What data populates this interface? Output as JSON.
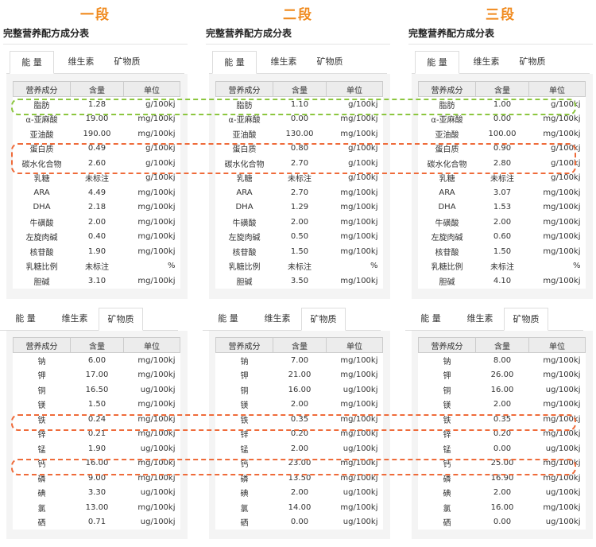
{
  "colors": {
    "stage_orange": "#f08a1e",
    "highlight_green": "#8cc63f",
    "highlight_orange": "#ef6b3a"
  },
  "stages": [
    "一段",
    "二段",
    "三段"
  ],
  "page_title": "完整营养配方成分表",
  "tabs": [
    "能 量",
    "维生素",
    "矿物质"
  ],
  "headers": [
    "营养成分",
    "含量",
    "单位"
  ],
  "energy_names": [
    "脂肪",
    "α-亚麻酸",
    "亚油酸",
    "蛋白质",
    "碳水化合物",
    "乳糖",
    "ARA",
    "DHA",
    "牛磺酸",
    "左旋肉碱",
    "核苷酸",
    "乳糖比例",
    "胆碱"
  ],
  "energy_units": [
    "g/100kj",
    "mg/100kj",
    "mg/100kj",
    "g/100kj",
    "g/100kj",
    "g/100kj",
    "mg/100kj",
    "mg/100kj",
    "mg/100kj",
    "mg/100kj",
    "mg/100kj",
    "%",
    "mg/100kj"
  ],
  "energy_values": [
    [
      "1.28",
      "19.00",
      "190.00",
      "0.49",
      "2.60",
      "未标注",
      "4.49",
      "2.18",
      "2.00",
      "0.40",
      "1.90",
      "未标注",
      "3.10"
    ],
    [
      "1.10",
      "0.00",
      "130.00",
      "0.80",
      "2.70",
      "未标注",
      "2.70",
      "1.29",
      "2.00",
      "0.50",
      "1.50",
      "未标注",
      "3.50"
    ],
    [
      "1.00",
      "0.00",
      "100.00",
      "0.90",
      "2.80",
      "未标注",
      "3.07",
      "1.53",
      "2.00",
      "0.60",
      "1.50",
      "未标注",
      "4.10"
    ]
  ],
  "mineral_names": [
    "钠",
    "钾",
    "铜",
    "镁",
    "铁",
    "锌",
    "锰",
    "钙",
    "磷",
    "碘",
    "氯",
    "硒"
  ],
  "mineral_units": [
    "mg/100kj",
    "mg/100kj",
    "ug/100kj",
    "mg/100kj",
    "mg/100kj",
    "mg/100kj",
    "ug/100kj",
    "mg/100kj",
    "mg/100kj",
    "ug/100kj",
    "mg/100kj",
    "ug/100kj"
  ],
  "mineral_values": [
    [
      "6.00",
      "17.00",
      "16.50",
      "1.50",
      "0.24",
      "0.21",
      "1.90",
      "16.00",
      "9.00",
      "3.30",
      "13.00",
      "0.71"
    ],
    [
      "7.00",
      "21.00",
      "16.00",
      "2.00",
      "0.35",
      "0.20",
      "2.00",
      "23.00",
      "13.50",
      "2.00",
      "14.00",
      "0.00"
    ],
    [
      "8.00",
      "26.00",
      "16.00",
      "2.00",
      "0.35",
      "0.20",
      "0.00",
      "25.00",
      "16.90",
      "2.00",
      "16.00",
      "0.00"
    ]
  ]
}
